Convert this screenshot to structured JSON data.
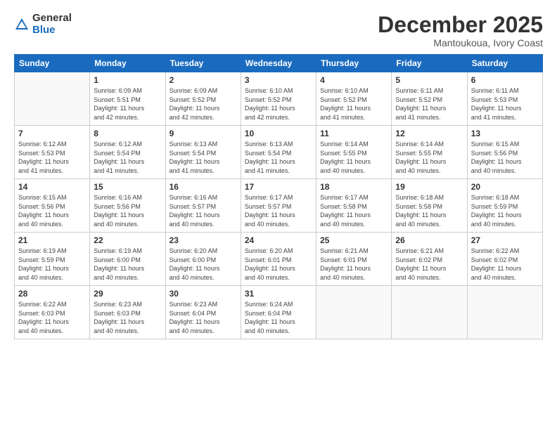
{
  "logo": {
    "general": "General",
    "blue": "Blue"
  },
  "title": "December 2025",
  "location": "Mantoukoua, Ivory Coast",
  "days_of_week": [
    "Sunday",
    "Monday",
    "Tuesday",
    "Wednesday",
    "Thursday",
    "Friday",
    "Saturday"
  ],
  "weeks": [
    [
      {
        "day": "",
        "info": ""
      },
      {
        "day": "1",
        "info": "Sunrise: 6:09 AM\nSunset: 5:51 PM\nDaylight: 11 hours\nand 42 minutes."
      },
      {
        "day": "2",
        "info": "Sunrise: 6:09 AM\nSunset: 5:52 PM\nDaylight: 11 hours\nand 42 minutes."
      },
      {
        "day": "3",
        "info": "Sunrise: 6:10 AM\nSunset: 5:52 PM\nDaylight: 11 hours\nand 42 minutes."
      },
      {
        "day": "4",
        "info": "Sunrise: 6:10 AM\nSunset: 5:52 PM\nDaylight: 11 hours\nand 41 minutes."
      },
      {
        "day": "5",
        "info": "Sunrise: 6:11 AM\nSunset: 5:52 PM\nDaylight: 11 hours\nand 41 minutes."
      },
      {
        "day": "6",
        "info": "Sunrise: 6:11 AM\nSunset: 5:53 PM\nDaylight: 11 hours\nand 41 minutes."
      }
    ],
    [
      {
        "day": "7",
        "info": "Sunrise: 6:12 AM\nSunset: 5:53 PM\nDaylight: 11 hours\nand 41 minutes."
      },
      {
        "day": "8",
        "info": "Sunrise: 6:12 AM\nSunset: 5:54 PM\nDaylight: 11 hours\nand 41 minutes."
      },
      {
        "day": "9",
        "info": "Sunrise: 6:13 AM\nSunset: 5:54 PM\nDaylight: 11 hours\nand 41 minutes."
      },
      {
        "day": "10",
        "info": "Sunrise: 6:13 AM\nSunset: 5:54 PM\nDaylight: 11 hours\nand 41 minutes."
      },
      {
        "day": "11",
        "info": "Sunrise: 6:14 AM\nSunset: 5:55 PM\nDaylight: 11 hours\nand 40 minutes."
      },
      {
        "day": "12",
        "info": "Sunrise: 6:14 AM\nSunset: 5:55 PM\nDaylight: 11 hours\nand 40 minutes."
      },
      {
        "day": "13",
        "info": "Sunrise: 6:15 AM\nSunset: 5:56 PM\nDaylight: 11 hours\nand 40 minutes."
      }
    ],
    [
      {
        "day": "14",
        "info": "Sunrise: 6:15 AM\nSunset: 5:56 PM\nDaylight: 11 hours\nand 40 minutes."
      },
      {
        "day": "15",
        "info": "Sunrise: 6:16 AM\nSunset: 5:56 PM\nDaylight: 11 hours\nand 40 minutes."
      },
      {
        "day": "16",
        "info": "Sunrise: 6:16 AM\nSunset: 5:57 PM\nDaylight: 11 hours\nand 40 minutes."
      },
      {
        "day": "17",
        "info": "Sunrise: 6:17 AM\nSunset: 5:57 PM\nDaylight: 11 hours\nand 40 minutes."
      },
      {
        "day": "18",
        "info": "Sunrise: 6:17 AM\nSunset: 5:58 PM\nDaylight: 11 hours\nand 40 minutes."
      },
      {
        "day": "19",
        "info": "Sunrise: 6:18 AM\nSunset: 5:58 PM\nDaylight: 11 hours\nand 40 minutes."
      },
      {
        "day": "20",
        "info": "Sunrise: 6:18 AM\nSunset: 5:59 PM\nDaylight: 11 hours\nand 40 minutes."
      }
    ],
    [
      {
        "day": "21",
        "info": "Sunrise: 6:19 AM\nSunset: 5:59 PM\nDaylight: 11 hours\nand 40 minutes."
      },
      {
        "day": "22",
        "info": "Sunrise: 6:19 AM\nSunset: 6:00 PM\nDaylight: 11 hours\nand 40 minutes."
      },
      {
        "day": "23",
        "info": "Sunrise: 6:20 AM\nSunset: 6:00 PM\nDaylight: 11 hours\nand 40 minutes."
      },
      {
        "day": "24",
        "info": "Sunrise: 6:20 AM\nSunset: 6:01 PM\nDaylight: 11 hours\nand 40 minutes."
      },
      {
        "day": "25",
        "info": "Sunrise: 6:21 AM\nSunset: 6:01 PM\nDaylight: 11 hours\nand 40 minutes."
      },
      {
        "day": "26",
        "info": "Sunrise: 6:21 AM\nSunset: 6:02 PM\nDaylight: 11 hours\nand 40 minutes."
      },
      {
        "day": "27",
        "info": "Sunrise: 6:22 AM\nSunset: 6:02 PM\nDaylight: 11 hours\nand 40 minutes."
      }
    ],
    [
      {
        "day": "28",
        "info": "Sunrise: 6:22 AM\nSunset: 6:03 PM\nDaylight: 11 hours\nand 40 minutes."
      },
      {
        "day": "29",
        "info": "Sunrise: 6:23 AM\nSunset: 6:03 PM\nDaylight: 11 hours\nand 40 minutes."
      },
      {
        "day": "30",
        "info": "Sunrise: 6:23 AM\nSunset: 6:04 PM\nDaylight: 11 hours\nand 40 minutes."
      },
      {
        "day": "31",
        "info": "Sunrise: 6:24 AM\nSunset: 6:04 PM\nDaylight: 11 hours\nand 40 minutes."
      },
      {
        "day": "",
        "info": ""
      },
      {
        "day": "",
        "info": ""
      },
      {
        "day": "",
        "info": ""
      }
    ]
  ]
}
